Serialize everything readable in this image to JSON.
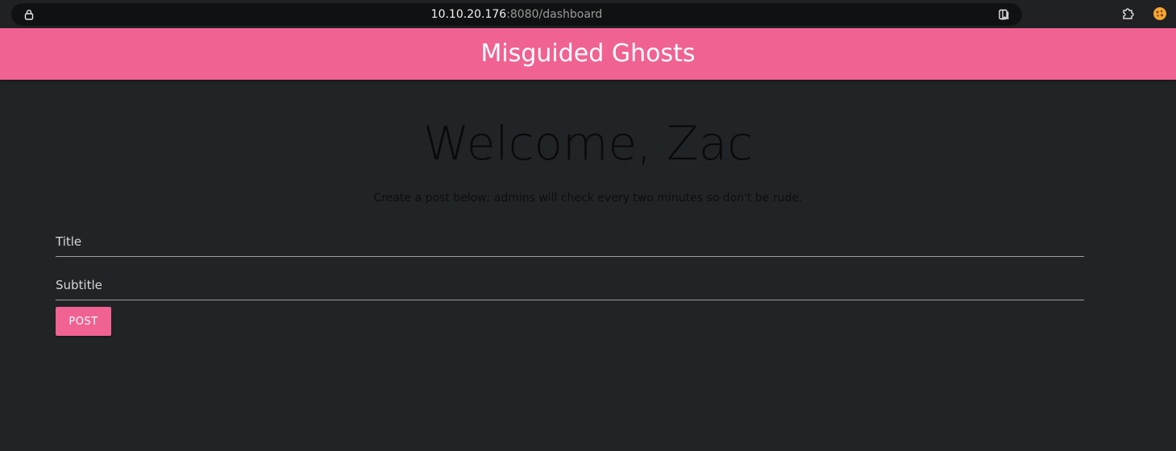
{
  "browser": {
    "url_host": "10.10.20.176",
    "url_path": ":8080/dashboard",
    "icons": [
      "lock-icon",
      "reader-view-icon",
      "extensions-icon",
      "profile-icon"
    ]
  },
  "header": {
    "title": "Misguided Ghosts",
    "color": "#f06292"
  },
  "main": {
    "welcome": "Welcome, Zac",
    "instructions": "Create a post below; admins will check every two minutes so don't be rude.",
    "title_placeholder": "Title",
    "subtitle_placeholder": "Subtitle",
    "post_label": "POST",
    "background": "#212427"
  }
}
